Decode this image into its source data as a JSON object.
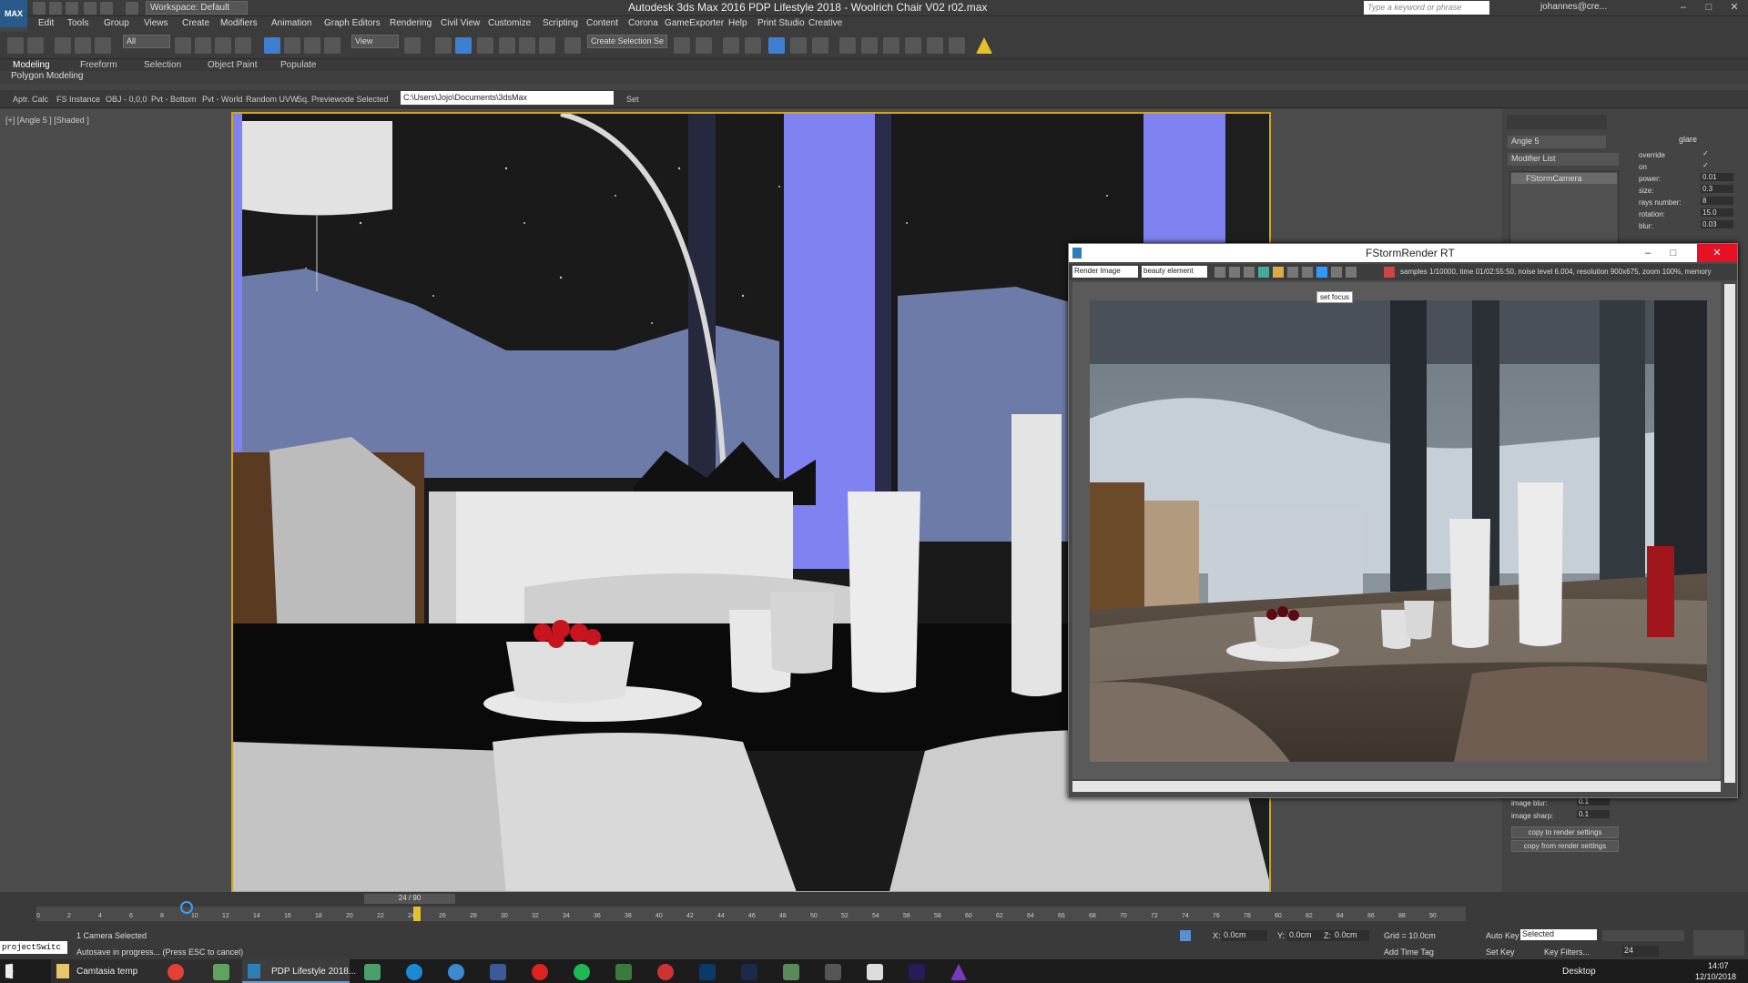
{
  "window": {
    "app_logo": "MAX",
    "title": "Autodesk 3ds Max 2016     PDP Lifestyle 2018 - Woolrich Chair V02 r02.max",
    "workspace": "Workspace: Default",
    "search_placeholder": "Type a keyword or phrase",
    "user": "johannes@cre...",
    "controls": [
      "–",
      "□",
      "✕"
    ]
  },
  "menus": [
    "Edit",
    "Tools",
    "Group",
    "Views",
    "Create",
    "Modifiers",
    "Animation",
    "Graph Editors",
    "Rendering",
    "Civil View",
    "Customize",
    "Scripting",
    "Content",
    "Corona",
    "GameExporter",
    "Help",
    "Print Studio",
    "Creative"
  ],
  "toolbar": {
    "filter": "All",
    "view": "View",
    "selection_set": "Create Selection Se"
  },
  "ribbon": {
    "tabs": [
      "Modeling",
      "Freeform",
      "Selection",
      "Object Paint",
      "Populate"
    ],
    "active": "Modeling",
    "panel": "Polygon Modeling"
  },
  "subbar": {
    "items": [
      "Aptr. Calc",
      "FS Instance",
      "OBJ - 0,0,0",
      "Pvt - Bottom",
      "Pvt - World",
      "Random UVW",
      "Sq. Preview",
      "ode Selected"
    ],
    "path": "C:\\Users\\Jojo\\Documents\\3dsMax",
    "set": "Set"
  },
  "viewport": {
    "label": "[+] [Angle 5 ] [Shaded ]"
  },
  "command_panel": {
    "object_name": "Angle 5",
    "modifier_list": "Modifier List",
    "stack_item": "FStormCamera",
    "rollout": "glare",
    "params": [
      {
        "label": "override",
        "value": "✓"
      },
      {
        "label": "on",
        "value": "✓"
      },
      {
        "label": "power:",
        "value": "0.01"
      },
      {
        "label": "size:",
        "value": "0.3"
      },
      {
        "label": "rays number:",
        "value": "8"
      },
      {
        "label": "rotation:",
        "value": "15.0"
      },
      {
        "label": "blur:",
        "value": "0.03"
      }
    ],
    "lower_params": [
      {
        "label": "image blur:",
        "value": "0.1"
      },
      {
        "label": "image sharp:",
        "value": "0.1"
      }
    ],
    "buttons": [
      "copy to render settings",
      "copy from render settings"
    ]
  },
  "fstorm": {
    "title": "FStormRender RT",
    "render_select": "Render Image",
    "element_select": "beauty element",
    "stats": "samples 1/10000, time 01/02:55:50, noise level 6.004, resolution 900x675, zoom 100%, memory",
    "tooltip": "set focus",
    "controls": {
      "min": "–",
      "max": "□",
      "close": "✕"
    }
  },
  "timeline": {
    "frame": "24 / 90",
    "ticks": [
      "0",
      "2",
      "4",
      "6",
      "8",
      "10",
      "12",
      "14",
      "16",
      "18",
      "20",
      "22",
      "24",
      "26",
      "28",
      "30",
      "32",
      "34",
      "36",
      "38",
      "40",
      "42",
      "44",
      "46",
      "48",
      "50",
      "52",
      "54",
      "56",
      "58",
      "60",
      "62",
      "64",
      "66",
      "68",
      "70",
      "72",
      "74",
      "76",
      "78",
      "80",
      "82",
      "84",
      "86",
      "88",
      "90"
    ]
  },
  "status": {
    "script_box": "projectSwitc",
    "selected": "1 Camera Selected",
    "prompt": "Autosave in progress... (Press ESC to cancel)",
    "x_label": "X:",
    "x": "0.0cm",
    "y_label": "Y:",
    "y": "0.0cm",
    "z_label": "Z:",
    "z": "0.0cm",
    "grid": "Grid = 10.0cm",
    "auto_key": "Auto Key",
    "set_key": "Set Key",
    "key_filters": "Key Filters...",
    "selected_drop": "Selected",
    "add_time_tag": "Add Time Tag",
    "frame_field": "24"
  },
  "taskbar": {
    "camtasia": "Camtasia temp",
    "max_task": "PDP Lifestyle 2018...",
    "desktop": "Desktop",
    "time": "14:07",
    "date": "12/10/2018"
  }
}
